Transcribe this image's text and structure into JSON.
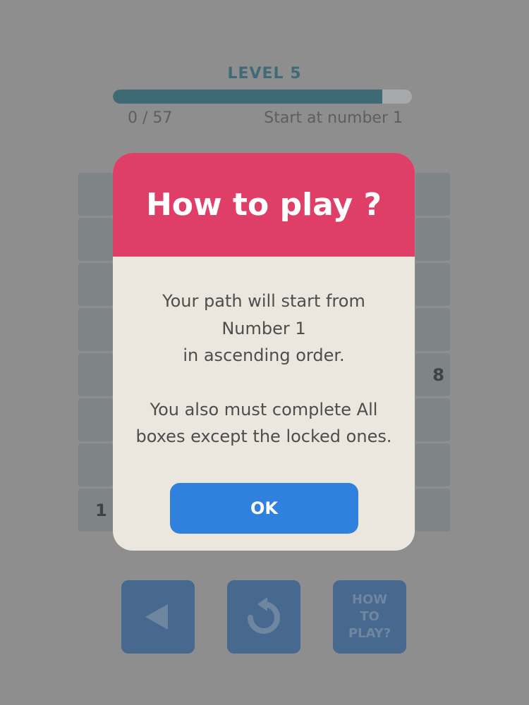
{
  "header": {
    "level_title": "LEVEL 5",
    "progress_fraction": 0.9,
    "count_text": "0 / 57",
    "hint_text": "Start at number 1"
  },
  "board": {
    "visible_numbers": {
      "right_col_number": "8",
      "left_bottom_number": "1"
    }
  },
  "modal": {
    "title": "How to play ?",
    "paragraph1_lines": [
      "Your path will start from",
      "Number 1",
      "in ascending order."
    ],
    "paragraph2_lines": [
      "You also must complete All",
      "boxes except the locked ones."
    ],
    "ok_label": "OK"
  },
  "controls": {
    "back_icon": "triangle-left-icon",
    "restart_icon": "restart-icon",
    "how_to_play_lines": [
      "HOW",
      "TO",
      "PLAY?"
    ]
  },
  "colors": {
    "backdrop": "#8f8e8e",
    "modal_header": "#df3e67",
    "modal_body": "#ebe7df",
    "ok_button": "#2f81dd",
    "control_button": "#47698f"
  }
}
